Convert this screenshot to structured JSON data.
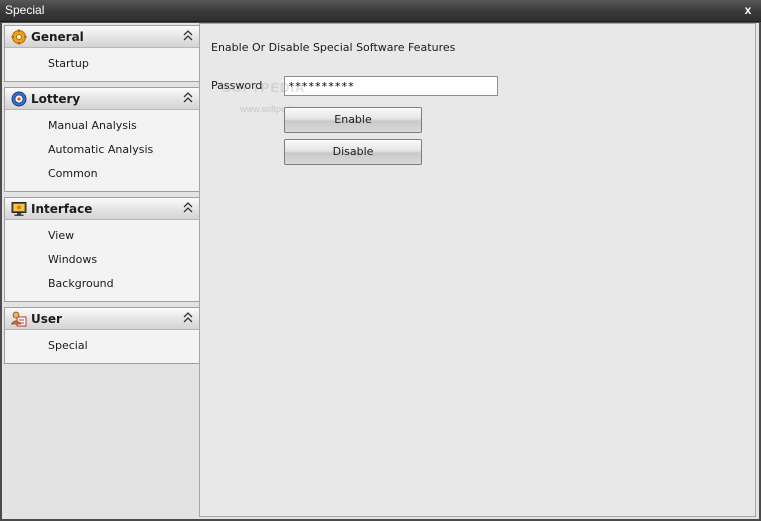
{
  "window": {
    "title": "Special",
    "close_label": "x"
  },
  "nav": {
    "groups": [
      {
        "title": "General",
        "icon": "gear-icon",
        "items": [
          "Startup"
        ]
      },
      {
        "title": "Lottery",
        "icon": "lottery-balls-icon",
        "items": [
          "Manual Analysis",
          "Automatic Analysis",
          "Common"
        ]
      },
      {
        "title": "Interface",
        "icon": "monitor-icon",
        "items": [
          "View",
          "Windows",
          "Background"
        ]
      },
      {
        "title": "User",
        "icon": "user-icon",
        "items": [
          "Special"
        ]
      }
    ]
  },
  "main": {
    "heading": "Enable Or Disable Special Software Features",
    "password_label": "Password",
    "password_value": "**********",
    "enable_label": "Enable",
    "disable_label": "Disable",
    "watermark": "SOFTPEDIA",
    "watermark_url": "www.softpedia.com"
  },
  "colors": {
    "titlebar": "#3a3a3a",
    "client": "#e3e3e3",
    "panel": "#e8e8e8",
    "nav_group": "#f3f3f3"
  }
}
